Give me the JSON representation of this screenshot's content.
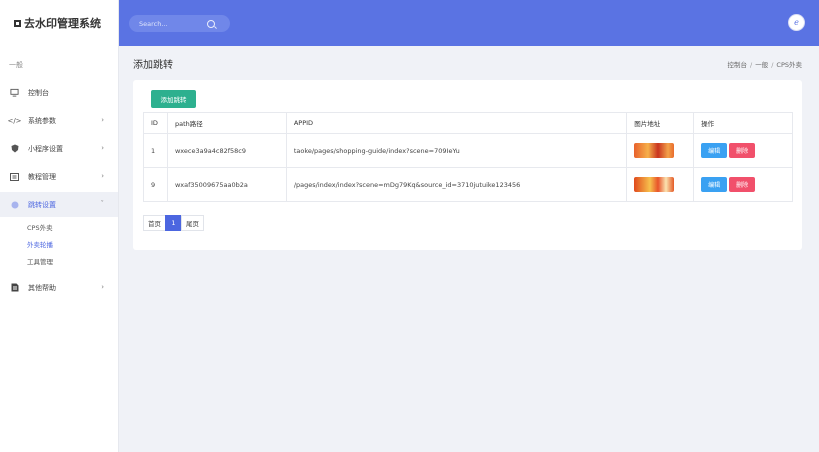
{
  "brand": {
    "title": "去水印管理系统"
  },
  "sidebar": {
    "section_label": "一般",
    "items": [
      {
        "label": "控制台",
        "icon": "monitor-icon"
      },
      {
        "label": "系统参数",
        "icon": "code-icon"
      },
      {
        "label": "小程序设置",
        "icon": "shield-icon"
      },
      {
        "label": "教程管理",
        "icon": "tutorial-icon"
      },
      {
        "label": "跳转设置",
        "icon": "redirect-icon"
      },
      {
        "label": "其他帮助",
        "icon": "help-document-icon"
      }
    ],
    "sub_items": [
      "CPS外卖",
      "外卖轮播",
      "工具管理"
    ]
  },
  "topbar": {
    "search_placeholder": "Search...",
    "avatar_glyph": "e"
  },
  "page": {
    "title": "添加跳转",
    "breadcrumb": [
      "控制台",
      "一般",
      "CPS外卖"
    ]
  },
  "toolbar": {
    "add_label": "添加跳转"
  },
  "table": {
    "headers": [
      "ID",
      "path路径",
      "APPID",
      "图片地址",
      "操作"
    ],
    "rows": [
      {
        "id": "1",
        "path": "wxece3a9a4c82f58c9",
        "appid": "taoke/pages/shopping-guide/index?scene=709IeYu",
        "edit": "编辑",
        "delete": "删除"
      },
      {
        "id": "9",
        "path": "wxaf35009675aa0b2a",
        "appid": "/pages/index/index?scene=mDg79Kq&source_id=3710jutuike123456",
        "edit": "编辑",
        "delete": "删除"
      }
    ]
  },
  "pager": {
    "first": "首页",
    "current": "1",
    "last": "尾页"
  },
  "colors": {
    "accent": "#5a73e3",
    "add_button": "#2db08f",
    "edit_button": "#3aa1f2",
    "delete_button": "#f1506b"
  }
}
